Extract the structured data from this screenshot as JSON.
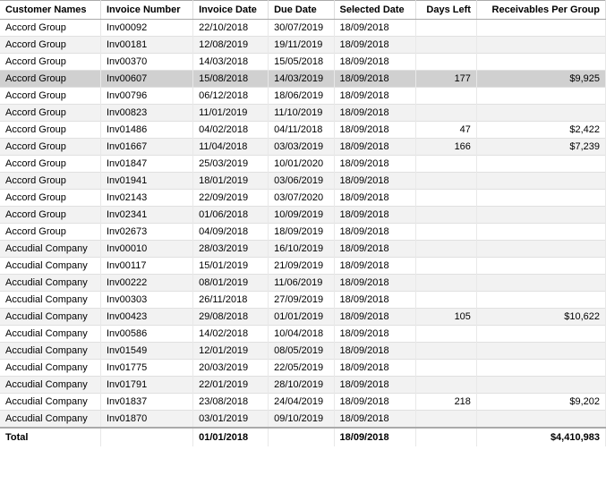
{
  "table": {
    "columns": [
      {
        "id": "customer",
        "label": "Customer Names"
      },
      {
        "id": "invoice_number",
        "label": "Invoice Number"
      },
      {
        "id": "invoice_date",
        "label": "Invoice Date"
      },
      {
        "id": "due_date",
        "label": "Due Date"
      },
      {
        "id": "selected_date",
        "label": "Selected Date"
      },
      {
        "id": "days_left",
        "label": "Days Left"
      },
      {
        "id": "receivables",
        "label": "Receivables Per Group"
      }
    ],
    "rows": [
      {
        "customer": "Accord Group",
        "invoice_number": "Inv00092",
        "invoice_date": "22/10/2018",
        "due_date": "30/07/2019",
        "selected_date": "18/09/2018",
        "days_left": "",
        "receivables": "",
        "selected": false
      },
      {
        "customer": "Accord Group",
        "invoice_number": "Inv00181",
        "invoice_date": "12/08/2019",
        "due_date": "19/11/2019",
        "selected_date": "18/09/2018",
        "days_left": "",
        "receivables": "",
        "selected": false
      },
      {
        "customer": "Accord Group",
        "invoice_number": "Inv00370",
        "invoice_date": "14/03/2018",
        "due_date": "15/05/2018",
        "selected_date": "18/09/2018",
        "days_left": "",
        "receivables": "",
        "selected": false
      },
      {
        "customer": "Accord Group",
        "invoice_number": "Inv00607",
        "invoice_date": "15/08/2018",
        "due_date": "14/03/2019",
        "selected_date": "18/09/2018",
        "days_left": "177",
        "receivables": "$9,925",
        "selected": true
      },
      {
        "customer": "Accord Group",
        "invoice_number": "Inv00796",
        "invoice_date": "06/12/2018",
        "due_date": "18/06/2019",
        "selected_date": "18/09/2018",
        "days_left": "",
        "receivables": "",
        "selected": false
      },
      {
        "customer": "Accord Group",
        "invoice_number": "Inv00823",
        "invoice_date": "11/01/2019",
        "due_date": "11/10/2019",
        "selected_date": "18/09/2018",
        "days_left": "",
        "receivables": "",
        "selected": false
      },
      {
        "customer": "Accord Group",
        "invoice_number": "Inv01486",
        "invoice_date": "04/02/2018",
        "due_date": "04/11/2018",
        "selected_date": "18/09/2018",
        "days_left": "47",
        "receivables": "$2,422",
        "selected": false
      },
      {
        "customer": "Accord Group",
        "invoice_number": "Inv01667",
        "invoice_date": "11/04/2018",
        "due_date": "03/03/2019",
        "selected_date": "18/09/2018",
        "days_left": "166",
        "receivables": "$7,239",
        "selected": false
      },
      {
        "customer": "Accord Group",
        "invoice_number": "Inv01847",
        "invoice_date": "25/03/2019",
        "due_date": "10/01/2020",
        "selected_date": "18/09/2018",
        "days_left": "",
        "receivables": "",
        "selected": false
      },
      {
        "customer": "Accord Group",
        "invoice_number": "Inv01941",
        "invoice_date": "18/01/2019",
        "due_date": "03/06/2019",
        "selected_date": "18/09/2018",
        "days_left": "",
        "receivables": "",
        "selected": false
      },
      {
        "customer": "Accord Group",
        "invoice_number": "Inv02143",
        "invoice_date": "22/09/2019",
        "due_date": "03/07/2020",
        "selected_date": "18/09/2018",
        "days_left": "",
        "receivables": "",
        "selected": false
      },
      {
        "customer": "Accord Group",
        "invoice_number": "Inv02341",
        "invoice_date": "01/06/2018",
        "due_date": "10/09/2019",
        "selected_date": "18/09/2018",
        "days_left": "",
        "receivables": "",
        "selected": false
      },
      {
        "customer": "Accord Group",
        "invoice_number": "Inv02673",
        "invoice_date": "04/09/2018",
        "due_date": "18/09/2019",
        "selected_date": "18/09/2018",
        "days_left": "",
        "receivables": "",
        "selected": false
      },
      {
        "customer": "Accudial Company",
        "invoice_number": "Inv00010",
        "invoice_date": "28/03/2019",
        "due_date": "16/10/2019",
        "selected_date": "18/09/2018",
        "days_left": "",
        "receivables": "",
        "selected": false
      },
      {
        "customer": "Accudial Company",
        "invoice_number": "Inv00117",
        "invoice_date": "15/01/2019",
        "due_date": "21/09/2019",
        "selected_date": "18/09/2018",
        "days_left": "",
        "receivables": "",
        "selected": false
      },
      {
        "customer": "Accudial Company",
        "invoice_number": "Inv00222",
        "invoice_date": "08/01/2019",
        "due_date": "11/06/2019",
        "selected_date": "18/09/2018",
        "days_left": "",
        "receivables": "",
        "selected": false
      },
      {
        "customer": "Accudial Company",
        "invoice_number": "Inv00303",
        "invoice_date": "26/11/2018",
        "due_date": "27/09/2019",
        "selected_date": "18/09/2018",
        "days_left": "",
        "receivables": "",
        "selected": false
      },
      {
        "customer": "Accudial Company",
        "invoice_number": "Inv00423",
        "invoice_date": "29/08/2018",
        "due_date": "01/01/2019",
        "selected_date": "18/09/2018",
        "days_left": "105",
        "receivables": "$10,622",
        "selected": false
      },
      {
        "customer": "Accudial Company",
        "invoice_number": "Inv00586",
        "invoice_date": "14/02/2018",
        "due_date": "10/04/2018",
        "selected_date": "18/09/2018",
        "days_left": "",
        "receivables": "",
        "selected": false
      },
      {
        "customer": "Accudial Company",
        "invoice_number": "Inv01549",
        "invoice_date": "12/01/2019",
        "due_date": "08/05/2019",
        "selected_date": "18/09/2018",
        "days_left": "",
        "receivables": "",
        "selected": false
      },
      {
        "customer": "Accudial Company",
        "invoice_number": "Inv01775",
        "invoice_date": "20/03/2019",
        "due_date": "22/05/2019",
        "selected_date": "18/09/2018",
        "days_left": "",
        "receivables": "",
        "selected": false
      },
      {
        "customer": "Accudial Company",
        "invoice_number": "Inv01791",
        "invoice_date": "22/01/2019",
        "due_date": "28/10/2019",
        "selected_date": "18/09/2018",
        "days_left": "",
        "receivables": "",
        "selected": false
      },
      {
        "customer": "Accudial Company",
        "invoice_number": "Inv01837",
        "invoice_date": "23/08/2018",
        "due_date": "24/04/2019",
        "selected_date": "18/09/2018",
        "days_left": "218",
        "receivables": "$9,202",
        "selected": false
      },
      {
        "customer": "Accudial Company",
        "invoice_number": "Inv01870",
        "invoice_date": "03/01/2019",
        "due_date": "09/10/2019",
        "selected_date": "18/09/2018",
        "days_left": "",
        "receivables": "",
        "selected": false
      }
    ],
    "footer": {
      "label": "Total",
      "invoice_date": "01/01/2018",
      "selected_date": "18/09/2018",
      "receivables": "$4,410,983"
    }
  }
}
